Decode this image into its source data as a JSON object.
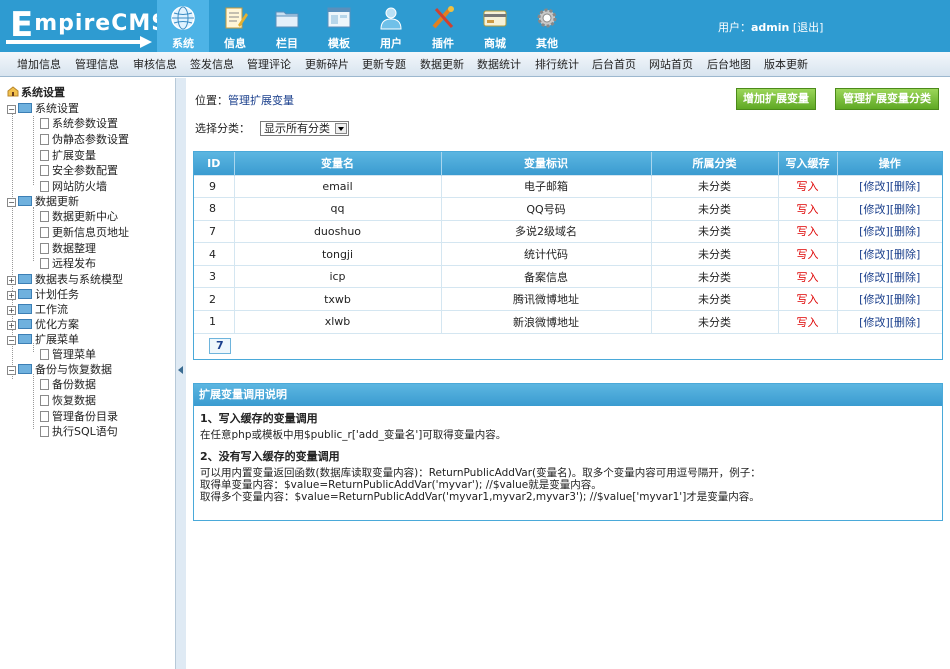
{
  "app": {
    "logo_text_big": "E",
    "logo_text_rest": "mpireCMS"
  },
  "main_nav": [
    {
      "label": "系统",
      "icon": "globe-icon",
      "active": true
    },
    {
      "label": "信息",
      "icon": "notepad-icon",
      "active": false
    },
    {
      "label": "栏目",
      "icon": "folder-icon",
      "active": false
    },
    {
      "label": "模板",
      "icon": "window-icon",
      "active": false
    },
    {
      "label": "用户",
      "icon": "user-icon",
      "active": false
    },
    {
      "label": "插件",
      "icon": "tools-icon",
      "active": false
    },
    {
      "label": "商城",
      "icon": "card-icon",
      "active": false
    },
    {
      "label": "其他",
      "icon": "gear-icon",
      "active": false
    }
  ],
  "user": {
    "prefix": "用户：",
    "name": "admin",
    "logout": "[退出]"
  },
  "sub_menu": [
    "增加信息",
    "管理信息",
    "审核信息",
    "签发信息",
    "管理评论",
    "更新碎片",
    "更新专题",
    "数据更新",
    "数据统计",
    "排行统计",
    "后台首页",
    "网站首页",
    "后台地图",
    "版本更新"
  ],
  "tree": {
    "root": "系统设置",
    "nodes": [
      {
        "label": "系统设置",
        "type": "folder",
        "expanded": true
      },
      {
        "label": "系统参数设置",
        "type": "doc"
      },
      {
        "label": "伪静态参数设置",
        "type": "doc"
      },
      {
        "label": "扩展变量",
        "type": "doc"
      },
      {
        "label": "安全参数配置",
        "type": "doc"
      },
      {
        "label": "网站防火墙",
        "type": "doc"
      },
      {
        "label": "数据更新",
        "type": "folder",
        "expanded": true
      },
      {
        "label": "数据更新中心",
        "type": "doc"
      },
      {
        "label": "更新信息页地址",
        "type": "doc"
      },
      {
        "label": "数据整理",
        "type": "doc"
      },
      {
        "label": "远程发布",
        "type": "doc"
      },
      {
        "label": "数据表与系统模型",
        "type": "folder",
        "expanded": false
      },
      {
        "label": "计划任务",
        "type": "folder",
        "expanded": false
      },
      {
        "label": "工作流",
        "type": "folder",
        "expanded": false
      },
      {
        "label": "优化方案",
        "type": "folder",
        "expanded": false
      },
      {
        "label": "扩展菜单",
        "type": "folder",
        "expanded": true
      },
      {
        "label": "管理菜单",
        "type": "doc"
      },
      {
        "label": "备份与恢复数据",
        "type": "folder",
        "expanded": true
      },
      {
        "label": "备份数据",
        "type": "doc"
      },
      {
        "label": "恢复数据",
        "type": "doc"
      },
      {
        "label": "管理备份目录",
        "type": "doc"
      },
      {
        "label": "执行SQL语句",
        "type": "doc"
      }
    ]
  },
  "page": {
    "location_prefix": "位置：",
    "location_link": "管理扩展变量",
    "btn_add": "增加扩展变量",
    "btn_manage_class": "管理扩展变量分类",
    "filter_label": "选择分类：",
    "filter_value": "显示所有分类"
  },
  "table": {
    "headers": [
      "ID",
      "变量名",
      "变量标识",
      "所属分类",
      "写入缓存",
      "操作"
    ],
    "rows": [
      {
        "id": "9",
        "name": "email",
        "label": "电子邮箱",
        "class": "未分类",
        "cache": "写入",
        "edit": "[修改]",
        "del": "[删除]"
      },
      {
        "id": "8",
        "name": "qq",
        "label": "QQ号码",
        "class": "未分类",
        "cache": "写入",
        "edit": "[修改]",
        "del": "[删除]"
      },
      {
        "id": "7",
        "name": "duoshuo",
        "label": "多说2级域名",
        "class": "未分类",
        "cache": "写入",
        "edit": "[修改]",
        "del": "[删除]"
      },
      {
        "id": "4",
        "name": "tongji",
        "label": "统计代码",
        "class": "未分类",
        "cache": "写入",
        "edit": "[修改]",
        "del": "[删除]"
      },
      {
        "id": "3",
        "name": "icp",
        "label": "备案信息",
        "class": "未分类",
        "cache": "写入",
        "edit": "[修改]",
        "del": "[删除]"
      },
      {
        "id": "2",
        "name": "txwb",
        "label": "腾讯微博地址",
        "class": "未分类",
        "cache": "写入",
        "edit": "[修改]",
        "del": "[删除]"
      },
      {
        "id": "1",
        "name": "xlwb",
        "label": "新浪微博地址",
        "class": "未分类",
        "cache": "写入",
        "edit": "[修改]",
        "del": "[删除]"
      }
    ],
    "pager": "7"
  },
  "help": {
    "title": "扩展变量调用说明",
    "s1_title": "1、写入缓存的变量调用",
    "s1_text": "在任意php或模板中用$public_r['add_变量名']可取得变量内容。",
    "s2_title": "2、没有写入缓存的变量调用",
    "s2_line1": "可以用内置变量返回函数(数据库读取变量内容)：ReturnPublicAddVar(变量名)。取多个变量内容可用逗号隔开，例子：",
    "s2_line2": "取得单变量内容：$value=ReturnPublicAddVar('myvar'); //$value就是变量内容。",
    "s2_line3": "取得多个变量内容：$value=ReturnPublicAddVar('myvar1,myvar2,myvar3'); //$value['myvar1']才是变量内容。"
  }
}
